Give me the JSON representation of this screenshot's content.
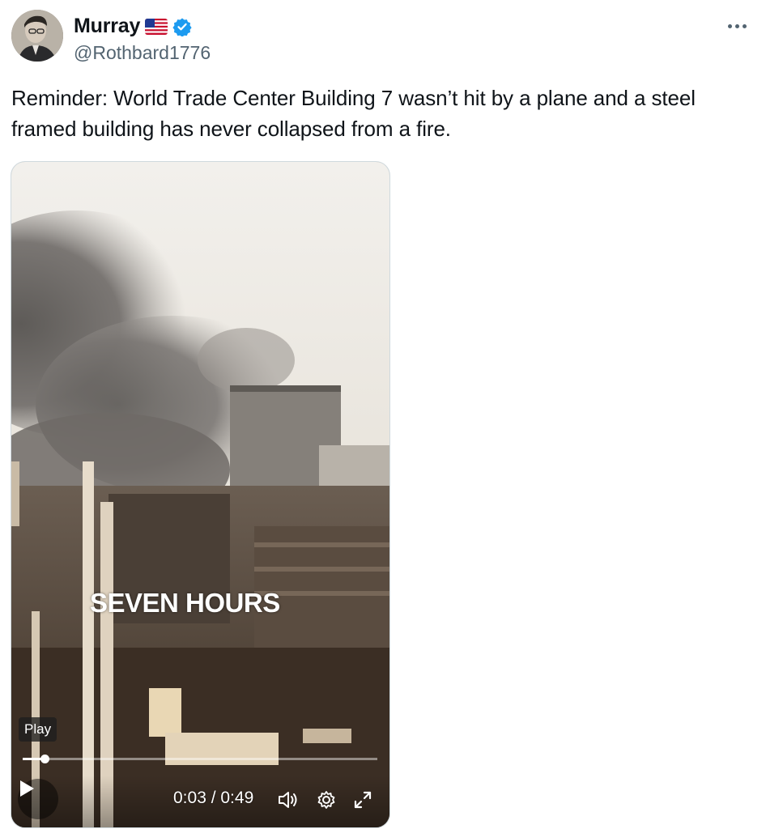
{
  "author": {
    "name": "Murray",
    "handle": "@Rothbard1776",
    "flag_icon": "us-flag-icon",
    "verified_icon": "verified-badge-icon",
    "verified_color": "#1d9bf0"
  },
  "tweet": {
    "text": "Reminder: World Trade Center Building 7 wasn’t hit by a plane and a steel framed building has never collapsed from a fire."
  },
  "video": {
    "caption": "SEVEN HOURS",
    "tooltip": "Play",
    "time_display": "0:03 / 0:49",
    "progress_fraction": 0.061,
    "icons": {
      "play": "play-icon",
      "volume": "volume-icon",
      "settings": "gear-icon",
      "fullscreen": "expand-icon"
    }
  },
  "colors": {
    "text_primary": "#0f1419",
    "text_secondary": "#536471",
    "border": "#cfd9de"
  }
}
